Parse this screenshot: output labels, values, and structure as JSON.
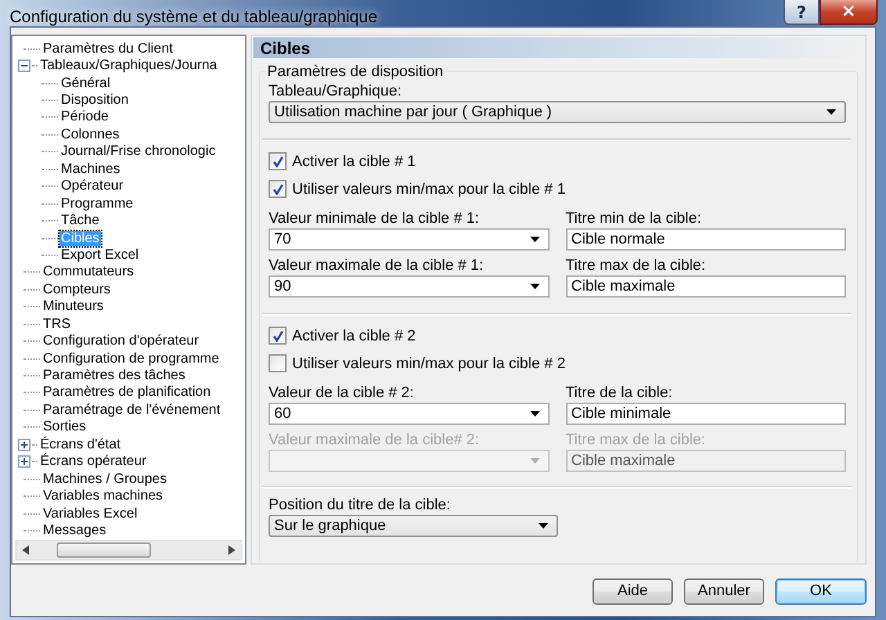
{
  "window": {
    "title": "Configuration du système et du tableau/graphique",
    "help_button": "?",
    "close_button": "×"
  },
  "tree": {
    "items": [
      {
        "label": "Paramètres du Client",
        "selected": false
      },
      {
        "label": "Tableaux/Graphiques/Journa",
        "selected": false,
        "expanded": true,
        "children": [
          {
            "label": "Général",
            "selected": false
          },
          {
            "label": "Disposition",
            "selected": false
          },
          {
            "label": "Période",
            "selected": false
          },
          {
            "label": "Colonnes",
            "selected": false
          },
          {
            "label": "Journal/Frise chronologic",
            "selected": false
          },
          {
            "label": "Machines",
            "selected": false
          },
          {
            "label": "Opérateur",
            "selected": false
          },
          {
            "label": "Programme",
            "selected": false
          },
          {
            "label": "Tâche",
            "selected": false
          },
          {
            "label": "Cibles",
            "selected": true
          },
          {
            "label": "Export Excel",
            "selected": false
          }
        ]
      },
      {
        "label": "Commutateurs",
        "selected": false
      },
      {
        "label": "Compteurs",
        "selected": false
      },
      {
        "label": "Minuteurs",
        "selected": false
      },
      {
        "label": "TRS",
        "selected": false
      },
      {
        "label": "Configuration d'opérateur",
        "selected": false
      },
      {
        "label": "Configuration de programme",
        "selected": false
      },
      {
        "label": "Paramètres des tâches",
        "selected": false
      },
      {
        "label": "Paramètres de planification",
        "selected": false
      },
      {
        "label": "Paramétrage de l'événement",
        "selected": false
      },
      {
        "label": "Sorties",
        "selected": false
      },
      {
        "label": "Écrans d'état",
        "selected": false,
        "expanded": false
      },
      {
        "label": "Écrans opérateur",
        "selected": false,
        "expanded": false
      },
      {
        "label": "Machines / Groupes",
        "selected": false
      },
      {
        "label": "Variables machines",
        "selected": false
      },
      {
        "label": "Variables Excel",
        "selected": false
      },
      {
        "label": "Messages",
        "selected": false
      }
    ]
  },
  "panel": {
    "title": "Cibles",
    "group_title": "Paramètres de disposition",
    "chart_field": {
      "label": "Tableau/Graphique:",
      "value": "Utilisation machine par jour  ( Graphique )"
    },
    "targets": [
      {
        "checkboxes": [
          {
            "label": "Activer la cible # 1",
            "checked": true
          },
          {
            "label": "Utiliser valeurs min/max pour la cible # 1",
            "checked": true
          }
        ],
        "fields": [
          {
            "label": "Valeur minimale de la cible # 1:",
            "value": "70",
            "kind": "dropdown",
            "disabled": false
          },
          {
            "label": "Titre min de la cible:",
            "value": "Cible normale",
            "kind": "text",
            "disabled": false
          },
          {
            "label": "Valeur maximale de la cible # 1:",
            "value": "90",
            "kind": "dropdown",
            "disabled": false
          },
          {
            "label": "Titre max de la cible:",
            "value": "Cible maximale",
            "kind": "text",
            "disabled": false
          }
        ]
      },
      {
        "checkboxes": [
          {
            "label": "Activer la cible # 2",
            "checked": true
          },
          {
            "label": "Utiliser valeurs min/max pour la cible # 2",
            "checked": false
          }
        ],
        "fields": [
          {
            "label": "Valeur de la cible # 2:",
            "value": "60",
            "kind": "dropdown",
            "disabled": false
          },
          {
            "label": "Titre de la cible:",
            "value": "Cible minimale",
            "kind": "text",
            "disabled": false
          },
          {
            "label": "Valeur maximale de la cible# 2:",
            "kind": "dropdown",
            "disabled": true
          },
          {
            "label": "Titre max de la cible:",
            "value": "Cible maximale",
            "kind": "text",
            "disabled": true
          }
        ]
      }
    ],
    "position_field": {
      "label": "Position du titre de la cible:",
      "value": "Sur le graphique"
    }
  },
  "buttons": [
    {
      "label": "Aide",
      "default": false
    },
    {
      "label": "Annuler",
      "default": false
    },
    {
      "label": "OK",
      "default": true
    }
  ]
}
